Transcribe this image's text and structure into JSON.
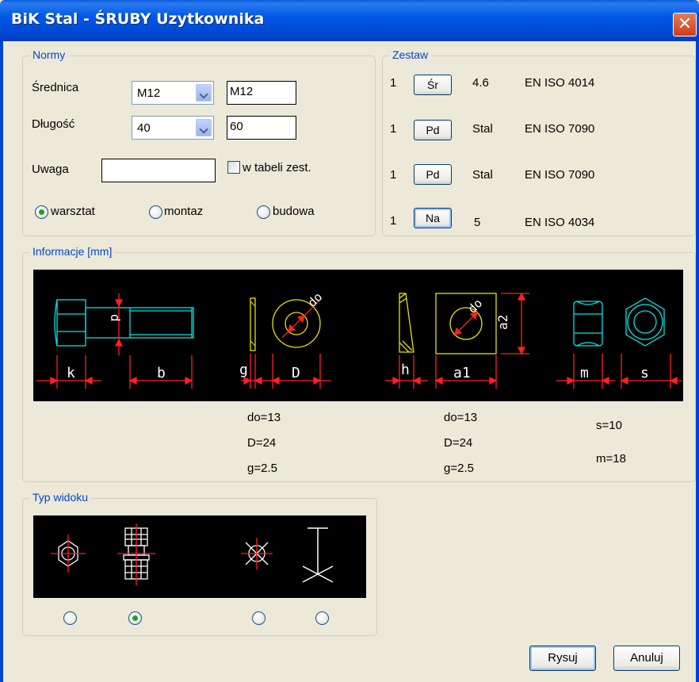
{
  "window": {
    "title": "BiK Stal - ŚRUBY Uzytkownika",
    "close_label": "✕"
  },
  "normy": {
    "legend": "Normy",
    "srednica_label": "Średnica",
    "srednica_combo": "M12",
    "srednica_text": "M12",
    "dlugosc_label": "Długość",
    "dlugosc_combo": "40",
    "dlugosc_text": "60",
    "uwaga_label": "Uwaga",
    "uwaga_value": "",
    "w_tabeli_label": "w tabeli zest.",
    "w_tabeli_checked": false,
    "radios": [
      {
        "label": "warsztat",
        "selected": true
      },
      {
        "label": "montaz",
        "selected": false
      },
      {
        "label": "budowa",
        "selected": false
      }
    ]
  },
  "zestaw": {
    "legend": "Zestaw",
    "rows": [
      {
        "qty": "1",
        "button": "Śr",
        "grade": "4.6",
        "norm": "EN ISO 4014"
      },
      {
        "qty": "1",
        "button": "Pd",
        "grade": "Stal",
        "norm": "EN ISO 7090"
      },
      {
        "qty": "1",
        "button": "Pd",
        "grade": "Stal",
        "norm": "EN ISO 7090"
      },
      {
        "qty": "1",
        "button": "Na",
        "grade": "5",
        "norm": "EN ISO 4034"
      }
    ]
  },
  "informacje": {
    "legend": "Informacje [mm]",
    "drawing_labels": {
      "k": "k",
      "b": "b",
      "d": "d",
      "g": "g",
      "D": "D",
      "do1": "do",
      "h": "h",
      "a1": "a1",
      "a2": "a2",
      "do2": "do",
      "m": "m",
      "s": "s"
    },
    "washer1": [
      "do=13",
      "D=24",
      "g=2.5"
    ],
    "washer2": [
      "do=13",
      "D=24",
      "g=2.5"
    ],
    "nut": [
      "s=10",
      "m=18"
    ]
  },
  "typ_widoku": {
    "legend": "Typ widoku",
    "selected_index": 1
  },
  "buttons": {
    "rysuj": "Rysuj",
    "anuluj": "Anuluj"
  },
  "colors": {
    "cyan": "#00e5e5",
    "yellow": "#e5e500",
    "red": "#ff2020",
    "legend": "#0046d5"
  }
}
